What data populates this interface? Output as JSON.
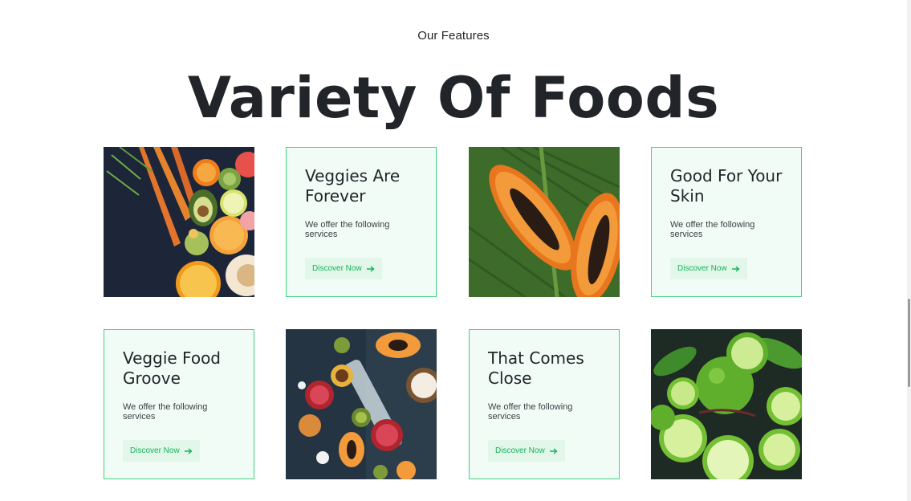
{
  "section": {
    "eyebrow": "Our Features",
    "title": "Variety Of Foods"
  },
  "cards": [
    {
      "title": "Veggies Are Forever",
      "description": "We offer the following services",
      "button": "Discover Now"
    },
    {
      "title": "Good For Your Skin",
      "description": "We offer the following services",
      "button": "Discover Now"
    },
    {
      "title": "Veggie Food Groove",
      "description": "We offer the following services",
      "button": "Discover Now"
    },
    {
      "title": "That Comes Close",
      "description": "We offer the following services",
      "button": "Discover Now"
    }
  ],
  "colors": {
    "accent": "#16b35a",
    "card_border": "#3fd37f",
    "card_bg": "#f2fcf6",
    "button_bg": "#e2f7ea",
    "text": "#212529"
  },
  "icons": {
    "button_icon": "arrow-right-icon"
  }
}
